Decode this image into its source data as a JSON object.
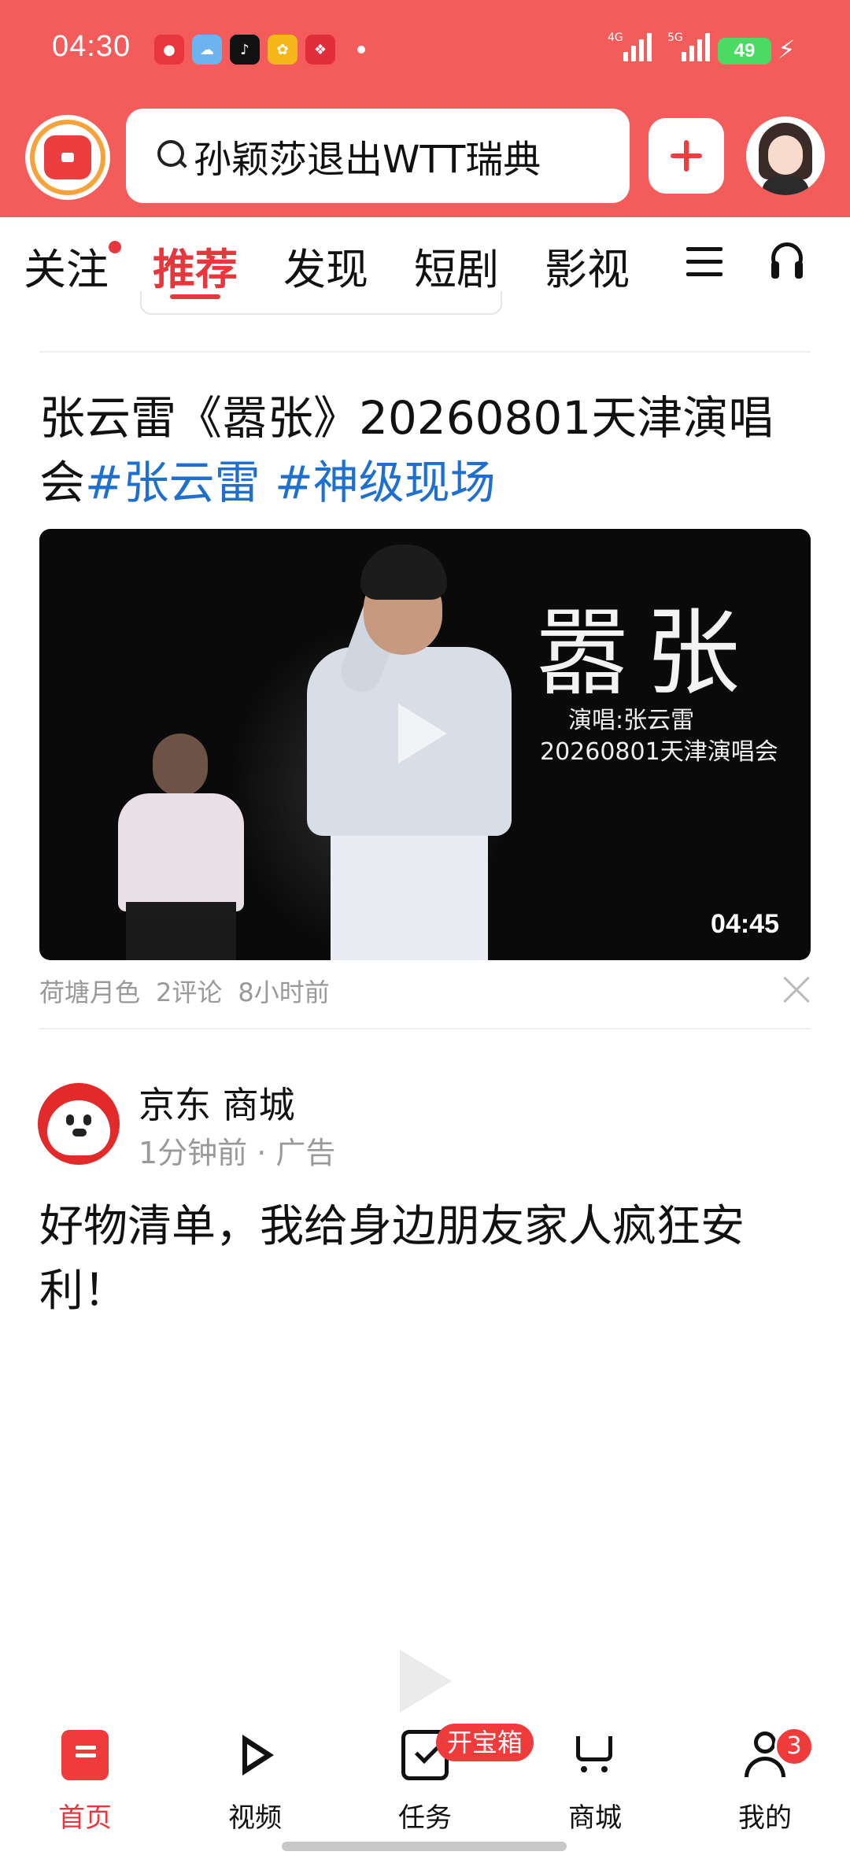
{
  "status_bar": {
    "time": "04:30",
    "signal1_label": "4G",
    "signal2_label": "5G",
    "battery": "49",
    "app_icons": [
      "red-app-icon",
      "weather-icon",
      "tiktok-icon",
      "yellow-app-icon",
      "pinduoduo-icon"
    ]
  },
  "header": {
    "search_text": "孙颖莎退出WTT瑞典"
  },
  "tabs": [
    {
      "label": "关注",
      "has_dot": true
    },
    {
      "label": "推荐",
      "active": true
    },
    {
      "label": "发现"
    },
    {
      "label": "短剧"
    },
    {
      "label": "影视"
    }
  ],
  "article": {
    "title_text": "张云雷《嚣张》20260801天津演唱会",
    "tag1": "#张云雷",
    "tag2": "#神级现场",
    "video": {
      "title": "嚣张",
      "subtitle1": "演唱:张云雷",
      "subtitle2": "20260801天津演唱会",
      "duration": "04:45"
    },
    "meta": {
      "source": "荷塘月色",
      "comments": "2评论",
      "time": "8小时前"
    }
  },
  "ad": {
    "name": "京东 商城",
    "time": "1分钟前 · 广告",
    "text": "好物清单，我给身边朋友家人疯狂安利！"
  },
  "bottom_nav": {
    "items": [
      {
        "label": "首页",
        "icon": "home-icon",
        "active": true
      },
      {
        "label": "视频",
        "icon": "video-icon"
      },
      {
        "label": "任务",
        "icon": "task-icon"
      },
      {
        "label": "商城",
        "icon": "cart-icon"
      },
      {
        "label": "我的",
        "icon": "profile-icon"
      }
    ],
    "task_badge": "开宝箱",
    "profile_badge": "3"
  },
  "colors": {
    "brand_red": "#f45c5c",
    "accent_red": "#e8363d",
    "tag_blue": "#1f6fd1"
  }
}
